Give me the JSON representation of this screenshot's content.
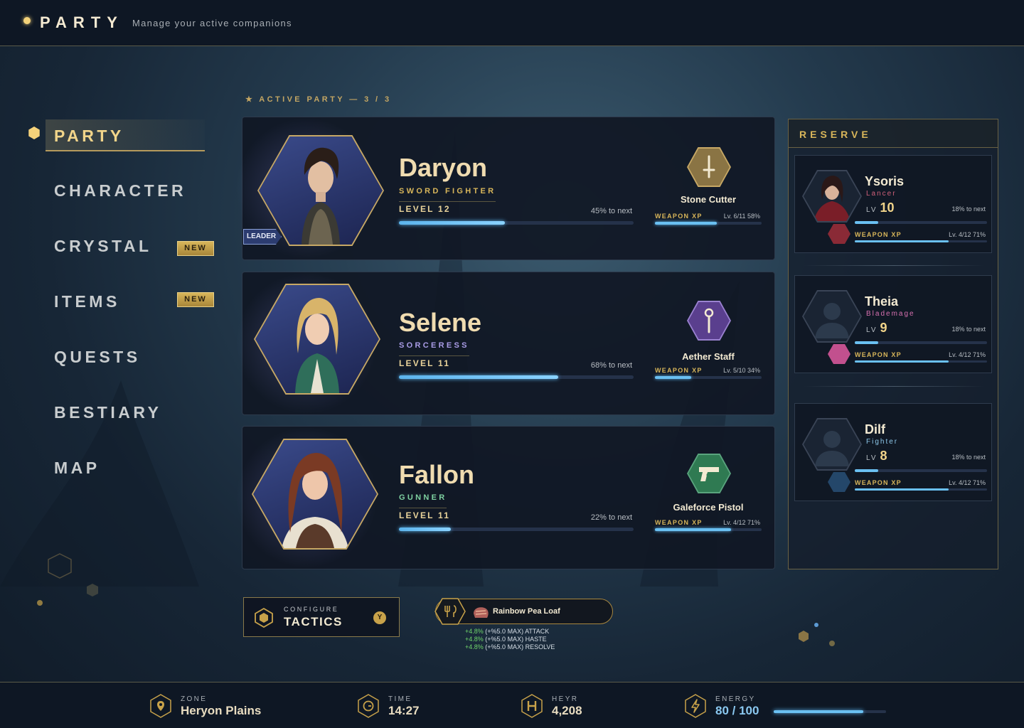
{
  "header": {
    "title": "PARTY",
    "subtitle": "Manage your active companions"
  },
  "nav": {
    "active": "PARTY",
    "items": [
      {
        "label": "CHARACTER",
        "badge": ""
      },
      {
        "label": "CRYSTAL",
        "badge": "NEW"
      },
      {
        "label": "ITEMS",
        "badge": "NEW"
      },
      {
        "label": "QUESTS",
        "badge": ""
      },
      {
        "label": "BESTIARY",
        "badge": ""
      },
      {
        "label": "MAP",
        "badge": ""
      }
    ]
  },
  "party": {
    "header": "★ ACTIVE PARTY — 3 / 3",
    "leader_tag": "LEADER",
    "members": [
      {
        "name": "Daryon",
        "class": "SWORD FIGHTER",
        "class_color": "#d8b65a",
        "level": "LEVEL 12",
        "to_next": "45% to next",
        "xp": 0.45,
        "weapon": {
          "name": "Stone Cutter",
          "icon": "sword-icon",
          "wxp_label": "WEAPON XP",
          "wlv": "Lv. 6/11  58%",
          "wxp": 0.58,
          "color": "#8a7444"
        }
      },
      {
        "name": "Selene",
        "class": "SORCERESS",
        "class_color": "#a99ce6",
        "level": "LEVEL 11",
        "to_next": "68% to next",
        "xp": 0.68,
        "weapon": {
          "name": "Aether Staff",
          "icon": "staff-icon",
          "wxp_label": "WEAPON XP",
          "wlv": "Lv. 5/10  34%",
          "wxp": 0.34,
          "color": "#5a3f8e"
        }
      },
      {
        "name": "Fallon",
        "class": "GUNNER",
        "class_color": "#7ed0a0",
        "level": "LEVEL 11",
        "to_next": "22% to next",
        "xp": 0.22,
        "weapon": {
          "name": "Galeforce Pistol",
          "icon": "pistol-icon",
          "wxp_label": "WEAPON XP",
          "wlv": "Lv. 4/12  71%",
          "wxp": 0.71,
          "color": "#2f7a52"
        }
      }
    ]
  },
  "reserve": {
    "header": "RESERVE",
    "members": [
      {
        "name": "Ysoris",
        "class": "Lancer",
        "class_color": "#d0607a",
        "lv_label": "LV",
        "level": "10",
        "to_next": "18% to next",
        "xp": 0.18,
        "wxp_label": "WEAPON XP",
        "wlv": "Lv. 4/12  71%",
        "wxp": 0.71,
        "weapon_color": "#8a2a36",
        "portrait": "character-portrait"
      },
      {
        "name": "Theia",
        "class": "Blademage",
        "class_color": "#d770b0",
        "lv_label": "LV",
        "level": "9",
        "to_next": "18% to next",
        "xp": 0.18,
        "wxp_label": "WEAPON XP",
        "wlv": "Lv. 4/12  71%",
        "wxp": 0.71,
        "weapon_color": "#c2508e",
        "portrait": "silhouette-icon"
      },
      {
        "name": "Dilf",
        "class": "Fighter",
        "class_color": "#8cc6e8",
        "lv_label": "LV",
        "level": "8",
        "to_next": "18% to next",
        "xp": 0.18,
        "wxp_label": "WEAPON XP",
        "wlv": "Lv. 4/12  71%",
        "wxp": 0.71,
        "weapon_color": "#24476a",
        "portrait": "silhouette-icon"
      }
    ]
  },
  "tactics": {
    "sub": "CONFIGURE",
    "label": "TACTICS",
    "button": "Y"
  },
  "food": {
    "name": "Rainbow Pea Loaf",
    "buffs": [
      {
        "pct": "+4.8%",
        "text": "(+%5.0 MAX) ATTACK"
      },
      {
        "pct": "+4.8%",
        "text": "(+%5.0 MAX) HASTE"
      },
      {
        "pct": "+4.8%",
        "text": "(+%5.0 MAX) RESOLVE"
      }
    ]
  },
  "status": {
    "zone": {
      "label": "ZONE",
      "value": "Heryon Plains"
    },
    "time": {
      "label": "TIME",
      "value": "14:27"
    },
    "heyr": {
      "label": "HEYR",
      "value": "4,208"
    },
    "energy": {
      "label": "ENERGY",
      "value": "80 / 100",
      "fraction": 0.8
    }
  }
}
